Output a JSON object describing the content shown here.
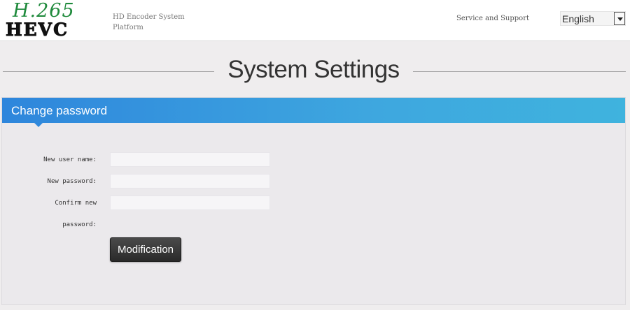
{
  "header": {
    "logo_top": "H.265",
    "logo_bottom": "HEVC",
    "platform_name": "HD Encoder System Platform",
    "service_link": "Service and Support",
    "language": {
      "selected": "English"
    }
  },
  "page": {
    "title": "System Settings"
  },
  "panel": {
    "title": "Change password",
    "fields": [
      {
        "label": "New user name:",
        "value": "",
        "placeholder": ""
      },
      {
        "label": "New password:",
        "value": "",
        "placeholder": ""
      },
      {
        "label_line1": "Confirm new",
        "label_line2": "password:",
        "value": "",
        "placeholder": ""
      }
    ],
    "submit_label": "Modification"
  },
  "colors": {
    "header_bg": "#ffffff",
    "page_bg": "#efedee",
    "panel_header_start": "#2e86dc",
    "panel_header_end": "#3fb3de",
    "button_bg": "#333333",
    "logo_green": "#1f8a3c"
  }
}
